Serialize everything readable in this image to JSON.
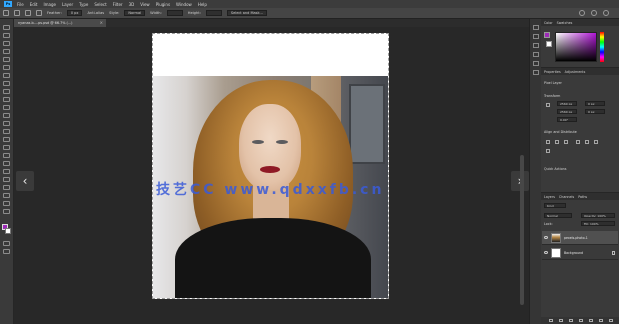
{
  "app": {
    "logo_text": "Ps"
  },
  "menu": {
    "items": [
      "File",
      "Edit",
      "Image",
      "Layer",
      "Type",
      "Select",
      "Filter",
      "3D",
      "View",
      "Plugins",
      "Window",
      "Help"
    ]
  },
  "options": {
    "feather_label": "Feather:",
    "feather_value": "0 px",
    "antialias_label": "Anti-alias",
    "style_label": "Style:",
    "style_value": "Normal",
    "width_label": "Width:",
    "height_label": "Height:",
    "select_mask_label": "Select and Mask..."
  },
  "document": {
    "tab_title": "nyanza-b-...ps.psd @ 66.7% (...)",
    "watermark": "技艺CC www.qdxxfb.cn"
  },
  "panels": {
    "color_tabs": [
      "Color",
      "Swatches"
    ],
    "properties_tabs": [
      "Properties",
      "Adjustments"
    ],
    "pixel_layer_label": "Pixel Layer",
    "transform_label": "Transform",
    "w_value": "2560 px",
    "h_value": "2560 px",
    "x_value": "0 px",
    "y_value": "0 px",
    "angle_value": "0.00°",
    "align_label": "Align and Distribute",
    "quick_actions_label": "Quick Actions",
    "layers_tabs": [
      "Layers",
      "Channels",
      "Paths"
    ],
    "kind_label": "Kind",
    "blend_mode": "Normal",
    "opacity_label": "Opacity: 100%",
    "lock_label": "Lock:",
    "fill_label": "Fill: 100%"
  },
  "layers": [
    {
      "name": "pexels-photo-1",
      "type": "img"
    },
    {
      "name": "Background",
      "type": "bg"
    }
  ],
  "colors": {
    "foreground": "#9d2ab8",
    "background": "#ffffff",
    "accent": "#31a8ff"
  }
}
